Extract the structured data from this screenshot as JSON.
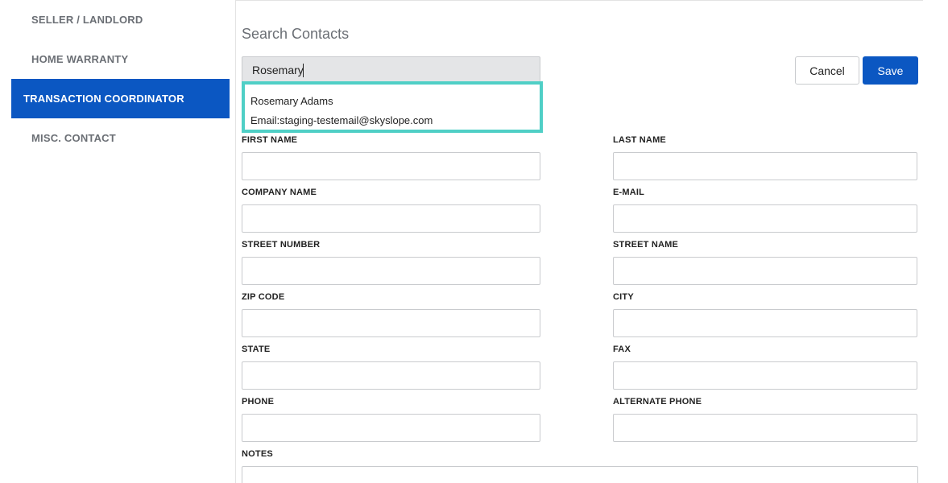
{
  "sidebar": {
    "items": [
      {
        "label": "SELLER / LANDLORD"
      },
      {
        "label": "HOME WARRANTY"
      },
      {
        "label": "TRANSACTION COORDINATOR"
      },
      {
        "label": "MISC. CONTACT"
      }
    ],
    "active_index": 2
  },
  "search": {
    "title": "Search Contacts",
    "value": "Rosemary",
    "suggestion": {
      "name": "Rosemary Adams",
      "email": "Email:staging-testemail@skyslope.com"
    }
  },
  "actions": {
    "cancel_label": "Cancel",
    "save_label": "Save"
  },
  "form": {
    "first_name": {
      "label": "FIRST NAME",
      "value": ""
    },
    "last_name": {
      "label": "LAST NAME",
      "value": ""
    },
    "company_name": {
      "label": "COMPANY NAME",
      "value": ""
    },
    "email": {
      "label": "E-MAIL",
      "value": ""
    },
    "street_number": {
      "label": "STREET NUMBER",
      "value": ""
    },
    "street_name": {
      "label": "STREET NAME",
      "value": ""
    },
    "zip_code": {
      "label": "ZIP CODE",
      "value": ""
    },
    "city": {
      "label": "CITY",
      "value": ""
    },
    "state": {
      "label": "STATE",
      "value": ""
    },
    "fax": {
      "label": "FAX",
      "value": ""
    },
    "phone": {
      "label": "PHONE",
      "value": ""
    },
    "alternate_phone": {
      "label": "ALTERNATE PHONE",
      "value": ""
    },
    "notes": {
      "label": "NOTES",
      "value": ""
    }
  },
  "colors": {
    "accent": "#0b57c2",
    "highlight_border": "#4fcfc6",
    "muted_text": "#6b6f75"
  }
}
